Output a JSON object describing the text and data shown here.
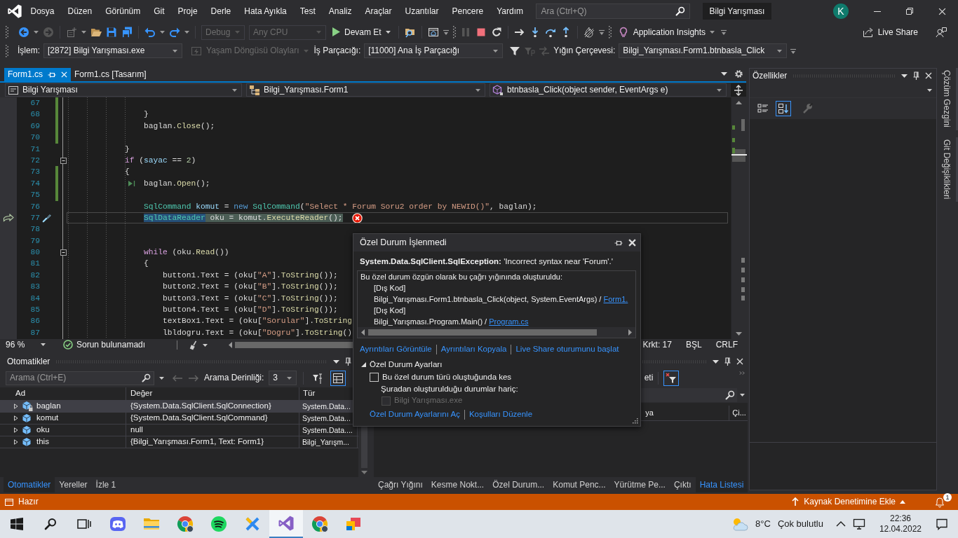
{
  "title_bar": {
    "menu": [
      "Dosya",
      "Düzen",
      "Görünüm",
      "Git",
      "Proje",
      "Derle",
      "Hata Ayıkla",
      "Test",
      "Analiz",
      "Araçlar",
      "Uzantılar",
      "Pencere",
      "Yardım"
    ],
    "search": {
      "placeholder": "Ara (Ctrl+Q)"
    },
    "solution": "Bilgi Yarışması",
    "avatar": "K"
  },
  "toolbar": {
    "configuration": {
      "value": "Debug",
      "disabled": true
    },
    "platform": {
      "value": "Any CPU",
      "disabled": true
    },
    "continue": "Devam Et",
    "insights": "Application Insights",
    "live_share": "Live Share"
  },
  "debug_location": {
    "process_label": "İşlem:",
    "process": "[2872] Bilgi Yarışması.exe",
    "lifecycle": {
      "label": "Yaşam Döngüsü Olayları",
      "disabled": true
    },
    "thread_label": "İş Parçacığı:",
    "thread": "[11000] Ana İş Parçacığı",
    "frame_label": "Yığın Çerçevesi:",
    "frame": "Bilgi_Yarışması.Form1.btnbasla_Click"
  },
  "document_tabs": [
    {
      "label": "Form1.cs",
      "selected": true
    },
    {
      "label": "Form1.cs [Tasarım]",
      "selected": false
    }
  ],
  "navigation_bar": [
    {
      "kind": "project",
      "label": "Bilgi Yarışması"
    },
    {
      "kind": "class",
      "label": "Bilgi_Yarışması.Form1"
    },
    {
      "kind": "method",
      "label": "btnbasla_Click(object sender, EventArgs e)"
    }
  ],
  "editor": {
    "lines": [
      {
        "number": "67",
        "changed": true,
        "fold": false,
        "current": false,
        "run_to_click": false
      },
      {
        "number": "68",
        "changed": true,
        "fold": false,
        "current": false,
        "run_to_click": false,
        "segments": [
          {
            "text": "                }",
            "kind": "plain"
          }
        ]
      },
      {
        "number": "69",
        "changed": true,
        "fold": false,
        "current": false,
        "run_to_click": false,
        "segments": [
          {
            "text": "                baglan.",
            "kind": "plain"
          },
          {
            "text": "Close",
            "kind": "method"
          },
          {
            "text": "();",
            "kind": "plain"
          }
        ]
      },
      {
        "number": "70",
        "changed": true,
        "fold": false,
        "current": false,
        "run_to_click": false
      },
      {
        "number": "71",
        "changed": false,
        "fold": false,
        "current": false,
        "run_to_click": false,
        "segments": [
          {
            "text": "            }",
            "kind": "plain"
          }
        ]
      },
      {
        "number": "72",
        "changed": false,
        "fold": true,
        "current": false,
        "run_to_click": false,
        "segments": [
          {
            "text": "            if",
            "kind": "control"
          },
          {
            "text": " (",
            "kind": "plain"
          },
          {
            "text": "sayac",
            "kind": "variable"
          },
          {
            "text": " == ",
            "kind": "plain"
          },
          {
            "text": "2",
            "kind": "number"
          },
          {
            "text": ")",
            "kind": "plain"
          }
        ]
      },
      {
        "number": "73",
        "changed": true,
        "fold": false,
        "current": false,
        "run_to_click": false,
        "segments": [
          {
            "text": "            {",
            "kind": "plain"
          }
        ]
      },
      {
        "number": "74",
        "changed": true,
        "fold": false,
        "current": false,
        "run_to_click": true,
        "segments": [
          {
            "text": "                baglan.",
            "kind": "plain"
          },
          {
            "text": "Open",
            "kind": "method"
          },
          {
            "text": "();",
            "kind": "plain"
          }
        ]
      },
      {
        "number": "75",
        "changed": true,
        "fold": false,
        "current": false,
        "run_to_click": false
      },
      {
        "number": "76",
        "changed": false,
        "fold": false,
        "current": false,
        "run_to_click": false,
        "segments": [
          {
            "text": "                SqlCommand",
            "kind": "type"
          },
          {
            "text": " komut",
            "kind": "variable"
          },
          {
            "text": " = ",
            "kind": "plain"
          },
          {
            "text": "new",
            "kind": "keyword"
          },
          {
            "text": " SqlCommand",
            "kind": "type"
          },
          {
            "text": "(",
            "kind": "plain"
          },
          {
            "text": "\"Select * Forum Soru2 order by NEWID()\"",
            "kind": "string"
          },
          {
            "text": ", baglan);",
            "kind": "plain"
          }
        ]
      },
      {
        "number": "77",
        "changed": false,
        "fold": false,
        "current": true,
        "run_to_click": false,
        "segments": [
          {
            "text": "                SqlDataReader",
            "kind": "type",
            "selected": true,
            "statement": true
          },
          {
            "text": " oku = komut.",
            "kind": "plain",
            "selected": false,
            "statement": true
          },
          {
            "text": "ExecuteReader",
            "kind": "method",
            "selected": false,
            "statement": true
          },
          {
            "text": "();",
            "kind": "plain",
            "selected": false,
            "statement": true
          }
        ]
      },
      {
        "number": "78",
        "changed": false,
        "fold": false,
        "current": false,
        "run_to_click": false
      },
      {
        "number": "79",
        "changed": false,
        "fold": false,
        "current": false,
        "run_to_click": false
      },
      {
        "number": "80",
        "changed": false,
        "fold": true,
        "current": false,
        "run_to_click": false,
        "segments": [
          {
            "text": "                while",
            "kind": "control"
          },
          {
            "text": " (oku.",
            "kind": "plain"
          },
          {
            "text": "Read",
            "kind": "method"
          },
          {
            "text": "())",
            "kind": "plain"
          }
        ]
      },
      {
        "number": "81",
        "changed": false,
        "fold": false,
        "current": false,
        "run_to_click": false,
        "segments": [
          {
            "text": "                {",
            "kind": "plain"
          }
        ]
      },
      {
        "number": "82",
        "changed": false,
        "fold": false,
        "current": false,
        "run_to_click": false,
        "segments": [
          {
            "text": "                    button1.Text = (oku[",
            "kind": "plain"
          },
          {
            "text": "\"A\"",
            "kind": "string"
          },
          {
            "text": "].",
            "kind": "plain"
          },
          {
            "text": "ToString",
            "kind": "method"
          },
          {
            "text": "());",
            "kind": "plain"
          }
        ]
      },
      {
        "number": "83",
        "changed": false,
        "fold": false,
        "current": false,
        "run_to_click": false,
        "segments": [
          {
            "text": "                    button2.Text = (oku[",
            "kind": "plain"
          },
          {
            "text": "\"B\"",
            "kind": "string"
          },
          {
            "text": "].",
            "kind": "plain"
          },
          {
            "text": "ToString",
            "kind": "method"
          },
          {
            "text": "());",
            "kind": "plain"
          }
        ]
      },
      {
        "number": "84",
        "changed": false,
        "fold": false,
        "current": false,
        "run_to_click": false,
        "segments": [
          {
            "text": "                    button3.Text = (oku[",
            "kind": "plain"
          },
          {
            "text": "\"C\"",
            "kind": "string"
          },
          {
            "text": "].",
            "kind": "plain"
          },
          {
            "text": "ToString",
            "kind": "method"
          },
          {
            "text": "());",
            "kind": "plain"
          }
        ]
      },
      {
        "number": "85",
        "changed": false,
        "fold": false,
        "current": false,
        "run_to_click": false,
        "segments": [
          {
            "text": "                    button4.Text = (oku[",
            "kind": "plain"
          },
          {
            "text": "\"D\"",
            "kind": "string"
          },
          {
            "text": "].",
            "kind": "plain"
          },
          {
            "text": "ToString",
            "kind": "method"
          },
          {
            "text": "());",
            "kind": "plain"
          }
        ]
      },
      {
        "number": "86",
        "changed": false,
        "fold": false,
        "current": false,
        "run_to_click": false,
        "segments": [
          {
            "text": "                    textBox1.Text = (oku[",
            "kind": "plain"
          },
          {
            "text": "\"Sorular\"",
            "kind": "string"
          },
          {
            "text": "].",
            "kind": "plain"
          },
          {
            "text": "ToString",
            "kind": "method"
          }
        ]
      },
      {
        "number": "87",
        "changed": false,
        "fold": false,
        "current": false,
        "run_to_click": false,
        "segments": [
          {
            "text": "                    lbldogru.Text = (oku[",
            "kind": "plain"
          },
          {
            "text": "\"Dogru\"",
            "kind": "string"
          },
          {
            "text": "].",
            "kind": "plain"
          },
          {
            "text": "ToString",
            "kind": "method"
          },
          {
            "text": "()",
            "kind": "plain"
          }
        ]
      }
    ],
    "zoom": "96 %",
    "issues": "Sorun bulunamadı",
    "column": "Krkt: 17",
    "indentation": "BŞL",
    "line_ending": "CRLF"
  },
  "exception": {
    "title": "Özel Durum İşlenmedi",
    "message": "**System.Data.SqlClient.SqlException:** 'Incorrect syntax near 'Forum'.'",
    "call_stack": {
      "title": "Bu özel durum özgün olarak bu çağrı yığınında oluşturuldu:",
      "frames": [
        {
          "text": "[Dış Kod]"
        },
        {
          "text": "Bilgi_Yarışması.Form1.btnbasla_Click(object, System.EventArgs) / ",
          "link": "Form1."
        },
        {
          "text": "[Dış Kod]"
        },
        {
          "text": "Bilgi_Yarışması.Program.Main() / ",
          "link": "Program.cs"
        }
      ]
    },
    "actions": [
      "Ayrıntıları Görüntüle",
      "Ayrıntıları Kopyala",
      "Live Share oturumunu başlat"
    ],
    "settings": {
      "title": "Özel Durum Ayarları",
      "expanded": true,
      "break_when_thrown": {
        "label": "Bu özel durum türü oluştuğunda kes",
        "checked": false
      },
      "except_label": "Şuradan oluşturulduğu durumlar hariç:",
      "modules": [
        {
          "label": "Bilgi Yarışması.exe",
          "checked": false,
          "disabled": true
        }
      ],
      "links": [
        "Özel Durum Ayarlarını Aç",
        "Koşulları Düzenle"
      ]
    }
  },
  "autos": {
    "title": "Otomatikler",
    "search": {
      "placeholder": "Arama (Ctrl+E)"
    },
    "depth_label": "Arama Derinliği:",
    "depth": "3",
    "toggles": [
      {
        "kind": "pin-filter",
        "on": false
      },
      {
        "kind": "table",
        "on": true
      }
    ],
    "columns": [
      "Ad",
      "Değer",
      "Tür"
    ],
    "rows": [
      {
        "name": "baglan",
        "value": "{System.Data.SqlClient.SqlConnection}",
        "type": "System.Data...",
        "kind": "private",
        "expanded": false,
        "selected": true
      },
      {
        "name": "komut",
        "value": "{System.Data.SqlClient.SqlCommand}",
        "type": "System.Data...",
        "kind": "local",
        "expanded": false,
        "selected": false
      },
      {
        "name": "oku",
        "value": "null",
        "type": "System.Data....",
        "kind": "local",
        "expanded": false,
        "selected": false
      },
      {
        "name": "this",
        "value": "{Bilgi_Yarışması.Form1, Text: Form1}",
        "type": "Bilgi_Yarışm...",
        "kind": "local",
        "expanded": false,
        "selected": false
      }
    ],
    "tabs": [
      {
        "label": "Otomatikler",
        "selected": true
      },
      {
        "label": "Yereller",
        "selected": false
      },
      {
        "label": "İzle 1",
        "selected": false
      }
    ]
  },
  "error_list": {
    "toolbar_text": "eti",
    "toggles": [
      {
        "kind": "clear-filter",
        "on": true
      }
    ],
    "columns": [
      "ya",
      "Çi..."
    ],
    "tabs": [
      {
        "label": "Çağrı Yığını",
        "selected": false
      },
      {
        "label": "Kesme Nokt...",
        "selected": false
      },
      {
        "label": "Özel Durum...",
        "selected": false
      },
      {
        "label": "Komut Penc...",
        "selected": false
      },
      {
        "label": "Yürütme Pe...",
        "selected": false
      },
      {
        "label": "Çıktı",
        "selected": false
      },
      {
        "label": "Hata Listesi",
        "selected": true
      }
    ]
  },
  "properties": {
    "title": "Özellikler",
    "sort_buttons": [
      {
        "kind": "categorized",
        "selected": false
      },
      {
        "kind": "alphabetical",
        "selected": true
      }
    ]
  },
  "side_tabs": [
    "Çözüm Gezgini",
    "Git Değişiklikleri"
  ],
  "status_bar": {
    "message": "Hazır",
    "source_control": "Kaynak Denetimine Ekle",
    "notifications": "1"
  },
  "taskbar": {
    "apps": [
      {
        "kind": "gamepad",
        "selected": false
      },
      {
        "kind": "folder",
        "selected": false
      },
      {
        "kind": "browser",
        "selected": false
      },
      {
        "kind": "music",
        "selected": false
      },
      {
        "kind": "tools",
        "selected": false
      },
      {
        "kind": "ide",
        "selected": true
      },
      {
        "kind": "browser",
        "selected": false
      },
      {
        "kind": "tiles",
        "selected": false
      }
    ],
    "temperature": "8°C",
    "weather": "Çok bulutlu",
    "time": "22:36",
    "date": "12.04.2022"
  }
}
